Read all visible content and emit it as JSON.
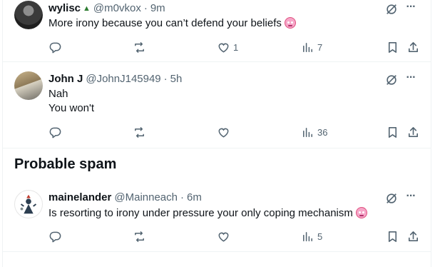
{
  "posts": [
    {
      "name": "wylisc",
      "badge_icon": "tree-badge-icon",
      "handle": "@m0vkox",
      "separator": "·",
      "time": "9m",
      "text": "More irony because you can’t defend your beliefs",
      "emoji": "pig-face-emoji",
      "replies": "",
      "reposts": "",
      "likes": "1",
      "views": "7"
    },
    {
      "name": "John J",
      "handle": "@JohnJ145949",
      "separator": "·",
      "time": "5h",
      "text_lines": [
        "Nah",
        "You won't"
      ],
      "replies": "",
      "reposts": "",
      "likes": "",
      "views": "36"
    }
  ],
  "section": {
    "title": "Probable spam"
  },
  "spam_post": {
    "name": "mainelander",
    "handle": "@Mainneach",
    "separator": "·",
    "time": "6m",
    "text": "Is resorting to irony under pressure your only coping mechanism",
    "emoji": "pig-face-emoji",
    "replies": "",
    "reposts": "",
    "likes": "",
    "views": "5"
  },
  "icons": {
    "grok": "slashed-circle-icon",
    "more": "more-dots-icon",
    "reply": "reply-icon",
    "repost": "repost-icon",
    "like": "heart-icon",
    "views": "views-chart-icon",
    "bookmark": "bookmark-icon",
    "share": "share-icon"
  },
  "colors": {
    "text": "#0f1419",
    "secondary": "#536471",
    "border": "#eff3f4"
  }
}
